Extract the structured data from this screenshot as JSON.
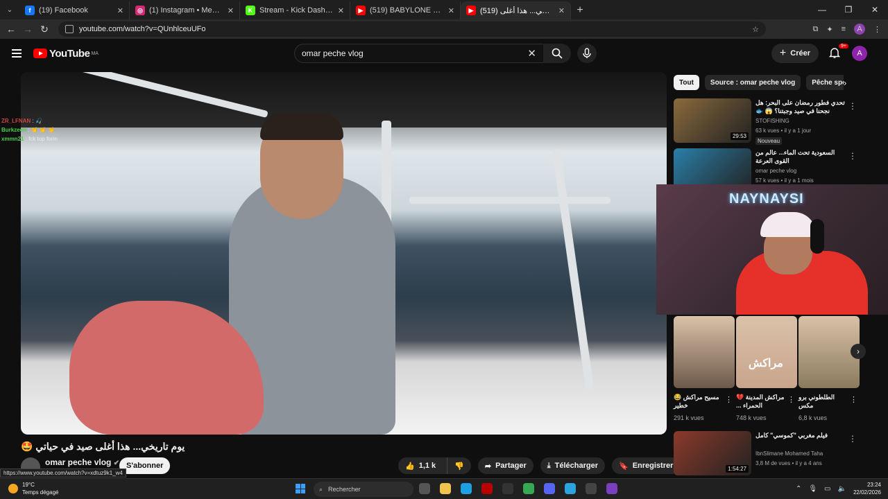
{
  "browser": {
    "tabs": [
      {
        "title": "(19) Facebook",
        "icon": "facebook-icon",
        "color": "#1877f2",
        "glyph": "f"
      },
      {
        "title": "(1) Instagram • Messages",
        "icon": "instagram-icon",
        "color": "#d62976",
        "glyph": "◎"
      },
      {
        "title": "Stream - Kick Dashboard",
        "icon": "kick-icon",
        "color": "#53fc18",
        "glyph": "K"
      },
      {
        "title": "(519) BABYLONE Kahlete Lailyon",
        "icon": "youtube-icon",
        "color": "#ff0000",
        "glyph": "▶"
      },
      {
        "title": "(519) يوم تاريخي... هذا أغلى",
        "icon": "youtube-icon",
        "color": "#ff0000",
        "glyph": "▶"
      }
    ],
    "url": "youtube.com/watch?v=QUnhlceuUFo",
    "profile_initial": "A"
  },
  "youtube": {
    "logo_text": "YouTube",
    "region": "MA",
    "search_value": "omar peche vlog",
    "create_label": "Créer",
    "notif_count": "9+",
    "avatar_initial": "A"
  },
  "chat": [
    {
      "user": "ZR_LFNAN",
      "msg": ": 🎣",
      "color": "#c44"
    },
    {
      "user": "Burkzeen",
      "msg": ": 👏 👏 👏",
      "color": "#49d049"
    },
    {
      "user": "xmmn21",
      "msg": ": fck top form",
      "color": "#49d049"
    }
  ],
  "video": {
    "title": "يوم تاريخي... هذا أغلى صيد في حياتي 🤩",
    "channel": "omar peche vlog",
    "subscribe": "S'abonner",
    "likes": "1,1 k",
    "share": "Partager",
    "download": "Télécharger",
    "save": "Enregistrer",
    "status_url": "https://www.youtube.com/watch?v=xdtuz9k1_w4"
  },
  "chips": [
    "Tout",
    "Source : omar peche vlog",
    "Pêche sportive"
  ],
  "recommendations": [
    {
      "title": "تحدي فطور رمضان على البحر: هل نجحنا في صيد وجبتنا؟ 😱 🐟",
      "channel": "STOFISHING",
      "meta": "63 k vues • il y a 1 jour",
      "duration": "29:53",
      "badge": "Nouveau",
      "thumb": "#8a6a3c"
    },
    {
      "title": "السعودية تحت الماء... عالم من القوى العرعة",
      "channel": "omar peche vlog",
      "meta": "57 k vues • il y a 1 mois",
      "duration": "",
      "badge": "",
      "thumb": "#2a7fa8"
    },
    {
      "title": "فيلم مغربي \"كموسي\" كامل",
      "channel": "IbnSlimane Mohamed Taha",
      "meta": "3,8 M de vues • il y a 4 ans",
      "duration": "1:54:27",
      "badge": "",
      "thumb": "#8b3a2a"
    }
  ],
  "stream_overlay": {
    "name": "NAYNAYSI"
  },
  "shorts": [
    {
      "title": "مسيح مراكش 😂 خطير",
      "views": "291 k vues",
      "thumb": "#6e5a4a"
    },
    {
      "title": "مراكش المدينة 💔 الحمراء ...",
      "views": "748 k vues",
      "thumb": "#c9a48c"
    },
    {
      "title": "الطلطوني برو مكس",
      "views": "6,8 k vues",
      "thumb": "#8a7a5c"
    }
  ],
  "shorts_overlay_text": "مراكش",
  "taskbar": {
    "temp": "19°C",
    "weather": "Temps dégagé",
    "search_placeholder": "Rechercher",
    "time": "23:24",
    "date": "22/02/2026"
  }
}
